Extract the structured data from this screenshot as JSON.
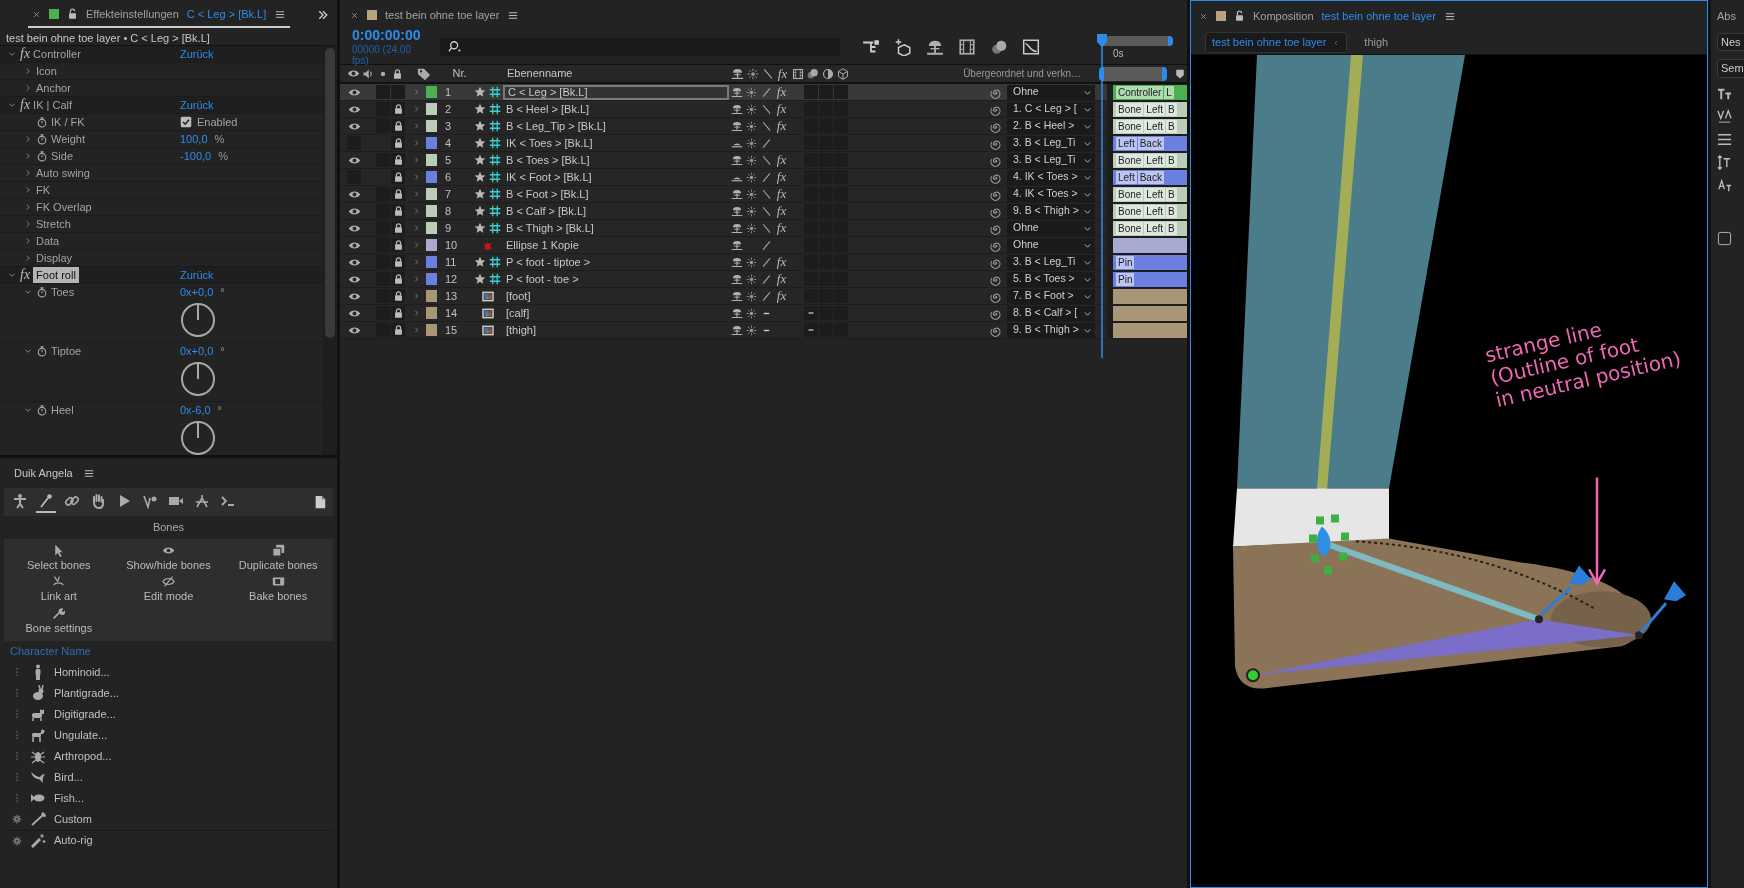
{
  "effects": {
    "tab_title": "Effekteinstellungen",
    "tab_layer": "C < Leg > [Bk.L]",
    "breadcrumb": "test bein ohne toe layer • C < Leg > [Bk.L]",
    "items": [
      {
        "kind": "effect",
        "icon": "fx",
        "label": "Controller",
        "reset": "Zurück",
        "expanded": true,
        "selected": false,
        "children": [
          {
            "kind": "group",
            "label": "Icon",
            "expanded": false
          },
          {
            "kind": "group",
            "label": "Anchor",
            "expanded": false
          }
        ]
      },
      {
        "kind": "effect",
        "icon": "fx",
        "label": "IK | Calf",
        "reset": "Zurück",
        "expanded": true,
        "selected": false,
        "children": [
          {
            "kind": "checkbox",
            "label": "IK / FK",
            "checked": true,
            "value": "Enabled"
          },
          {
            "kind": "param",
            "label": "Weight",
            "value": "100,0",
            "unit": "%",
            "expanded": false
          },
          {
            "kind": "param",
            "label": "Side",
            "value": "-100,0",
            "unit": "%",
            "expanded": false
          },
          {
            "kind": "group",
            "label": "Auto swing",
            "expanded": false
          },
          {
            "kind": "group",
            "label": "FK",
            "expanded": false
          },
          {
            "kind": "group",
            "label": "FK Overlap",
            "expanded": false
          },
          {
            "kind": "group",
            "label": "Stretch",
            "expanded": false
          },
          {
            "kind": "group",
            "label": "Data",
            "expanded": false
          },
          {
            "kind": "group",
            "label": "Display",
            "expanded": false
          }
        ]
      },
      {
        "kind": "effect",
        "icon": "fx",
        "label": "Foot roll",
        "reset": "Zurück",
        "expanded": true,
        "selected": true,
        "children": [
          {
            "kind": "angle",
            "label": "Toes",
            "value": "0x+0,0",
            "unit": "°",
            "expanded": true
          },
          {
            "kind": "angle",
            "label": "Tiptoe",
            "value": "0x+0,0",
            "unit": "°",
            "expanded": true
          },
          {
            "kind": "angle",
            "label": "Heel",
            "value": "0x-6,0",
            "unit": "°",
            "expanded": true
          }
        ]
      }
    ]
  },
  "duik": {
    "title": "Duik Angela",
    "tools": [
      {
        "kind": "rig",
        "selected": false
      },
      {
        "kind": "bones",
        "selected": true
      },
      {
        "kind": "links",
        "selected": false
      },
      {
        "kind": "hand",
        "selected": false
      },
      {
        "kind": "play",
        "selected": false
      },
      {
        "kind": "curve",
        "selected": false
      },
      {
        "kind": "camera",
        "selected": false
      },
      {
        "kind": "tools",
        "selected": false
      },
      {
        "kind": "terminal",
        "selected": false
      }
    ],
    "section": "Bones",
    "actions": [
      {
        "kind": "select",
        "label": "Select bones"
      },
      {
        "kind": "showhide",
        "label": "Show/hide bones"
      },
      {
        "kind": "duplicate",
        "label": "Duplicate bones"
      },
      {
        "kind": "linkart",
        "label": "Link art"
      },
      {
        "kind": "editmode",
        "label": "Edit mode"
      },
      {
        "kind": "bake",
        "label": "Bake bones"
      },
      {
        "kind": "settings",
        "label": "Bone settings"
      }
    ],
    "character_name": {
      "placeholder": "Character Name"
    },
    "templates": [
      {
        "kind": "hominoid",
        "label": "Hominoid..."
      },
      {
        "kind": "plantigrade",
        "label": "Plantigrade..."
      },
      {
        "kind": "digitigrade",
        "label": "Digitigrade..."
      },
      {
        "kind": "ungulate",
        "label": "Ungulate..."
      },
      {
        "kind": "arthropod",
        "label": "Arthropod..."
      },
      {
        "kind": "bird",
        "label": "Bird..."
      },
      {
        "kind": "fish",
        "label": "Fish..."
      },
      {
        "kind": "custom",
        "label": "Custom"
      },
      {
        "kind": "autorig",
        "label": "Auto-rig"
      }
    ]
  },
  "timeline": {
    "tab_title": "test bein ohne toe layer",
    "timecode": "0:00:00:00",
    "frame_info": "00000 (24.00 fps)",
    "ruler_label": "0s",
    "columns": {
      "nr": "Nr.",
      "name": "Ebenenname",
      "fx": "fx",
      "parent": "Übergeordnet und verkn…"
    },
    "layers": [
      {
        "nr": "1",
        "name": "C < Leg > [Bk.L]",
        "kind": "null",
        "color": "#4caf50",
        "visible": true,
        "locked": false,
        "shy": false,
        "quality_shown": true,
        "draft": false,
        "fx": "fx",
        "parent": "Ohne",
        "tags": [
          "Controller",
          "L"
        ],
        "selected": true
      },
      {
        "nr": "2",
        "name": "B < Heel > [Bk.L]",
        "kind": "null",
        "color": "#b9cdb9",
        "visible": true,
        "locked": true,
        "shy": false,
        "quality_shown": true,
        "draft": true,
        "fx": "fx",
        "parent": "1. C < Leg > [",
        "tags": [
          "Bone",
          "Left",
          "B"
        ],
        "selected": false
      },
      {
        "nr": "3",
        "name": "B < Leg_Tip > [Bk.L]",
        "kind": "null",
        "color": "#b9cdb9",
        "visible": true,
        "locked": true,
        "shy": false,
        "quality_shown": true,
        "draft": true,
        "fx": "fx",
        "parent": "2. B < Heel >",
        "tags": [
          "Bone",
          "Left",
          "B"
        ],
        "selected": false
      },
      {
        "nr": "4",
        "name": "IK < Toes > [Bk.L]",
        "kind": "null",
        "color": "#6b7fe0",
        "visible": false,
        "locked": true,
        "shy": true,
        "quality_shown": true,
        "draft": false,
        "parent": "3. B < Leg_Ti",
        "tags": [
          "Left",
          "Back"
        ],
        "selected": false
      },
      {
        "nr": "5",
        "name": "B < Toes > [Bk.L]",
        "kind": "null",
        "color": "#b9cdb9",
        "visible": true,
        "locked": true,
        "shy": false,
        "quality_shown": true,
        "draft": true,
        "fx": "fx",
        "parent": "3. B < Leg_Ti",
        "tags": [
          "Bone",
          "Left",
          "B"
        ],
        "selected": false
      },
      {
        "nr": "6",
        "name": "IK < Foot > [Bk.L]",
        "kind": "null",
        "color": "#6b7fe0",
        "visible": false,
        "locked": true,
        "shy": true,
        "quality_shown": true,
        "draft": false,
        "fx": "fx",
        "parent": "4. IK < Toes >",
        "tags": [
          "Left",
          "Back"
        ],
        "selected": false
      },
      {
        "nr": "7",
        "name": "B < Foot > [Bk.L]",
        "kind": "null",
        "color": "#b9cdb9",
        "visible": true,
        "locked": true,
        "shy": false,
        "quality_shown": true,
        "draft": true,
        "fx": "fx",
        "parent": "4. IK < Toes >",
        "tags": [
          "Bone",
          "Left",
          "B"
        ],
        "selected": false
      },
      {
        "nr": "8",
        "name": "B < Calf > [Bk.L]",
        "kind": "null",
        "color": "#b9cdb9",
        "visible": true,
        "locked": true,
        "shy": false,
        "quality_shown": true,
        "draft": true,
        "fx": "fx",
        "parent": "9. B < Thigh >",
        "tags": [
          "Bone",
          "Left",
          "B"
        ],
        "selected": false
      },
      {
        "nr": "9",
        "name": "B < Thigh > [Bk.L]",
        "kind": "null",
        "color": "#b9cdb9",
        "visible": true,
        "locked": true,
        "shy": false,
        "quality_shown": true,
        "draft": true,
        "fx": "fx",
        "parent": "Ohne",
        "tags": [
          "Bone",
          "Left",
          "B"
        ],
        "selected": false
      },
      {
        "nr": "10",
        "name": "Ellipse 1 Kopie",
        "kind": "shape",
        "color": "#a9a9d1",
        "visible": true,
        "locked": true,
        "shy": false,
        "quality_shown": true,
        "draft": false,
        "parent": "Ohne",
        "selected": false
      },
      {
        "nr": "11",
        "name": "P < foot - tiptoe >",
        "kind": "null",
        "color": "#6b7fe0",
        "visible": true,
        "locked": true,
        "shy": false,
        "quality_shown": true,
        "draft": false,
        "fx": "fx",
        "parent": "3. B < Leg_Ti",
        "tags": [
          "Pin"
        ],
        "selected": false
      },
      {
        "nr": "12",
        "name": "P < foot - toe >",
        "kind": "null",
        "color": "#6b7fe0",
        "visible": true,
        "locked": true,
        "shy": false,
        "quality_shown": true,
        "draft": false,
        "fx": "fx",
        "parent": "5. B < Toes >",
        "tags": [
          "Pin"
        ],
        "selected": false
      },
      {
        "nr": "13",
        "name": "[foot]",
        "kind": "footage",
        "color": "#a89677",
        "visible": true,
        "locked": true,
        "shy": false,
        "quality_shown": true,
        "draft": false,
        "fx": "fx",
        "parent": "7. B < Foot >",
        "selected": false
      },
      {
        "nr": "14",
        "name": "[calf]",
        "kind": "footage",
        "color": "#a89677",
        "visible": true,
        "locked": true,
        "shy": false,
        "quality_shown": false,
        "parent": "8. B < Calf > [",
        "selected": false
      },
      {
        "nr": "15",
        "name": "[thigh]",
        "kind": "footage",
        "color": "#a89677",
        "visible": true,
        "locked": true,
        "shy": false,
        "quality_shown": false,
        "parent": "9. B < Thigh >",
        "selected": false
      }
    ]
  },
  "composition": {
    "tab_label": "Komposition",
    "name": "test bein ohne toe layer",
    "breadcrumbs": [
      {
        "label": "test bein ohne toe layer",
        "selected": true
      },
      {
        "label": "thigh",
        "selected": false
      }
    ],
    "annotation": [
      "strange line",
      "(Outline of foot",
      "in neutral position)"
    ]
  },
  "right_panel": {
    "title": "Abs",
    "fields": [
      "Nes",
      "Sem"
    ],
    "checkbox": {
      "checked": false
    }
  }
}
